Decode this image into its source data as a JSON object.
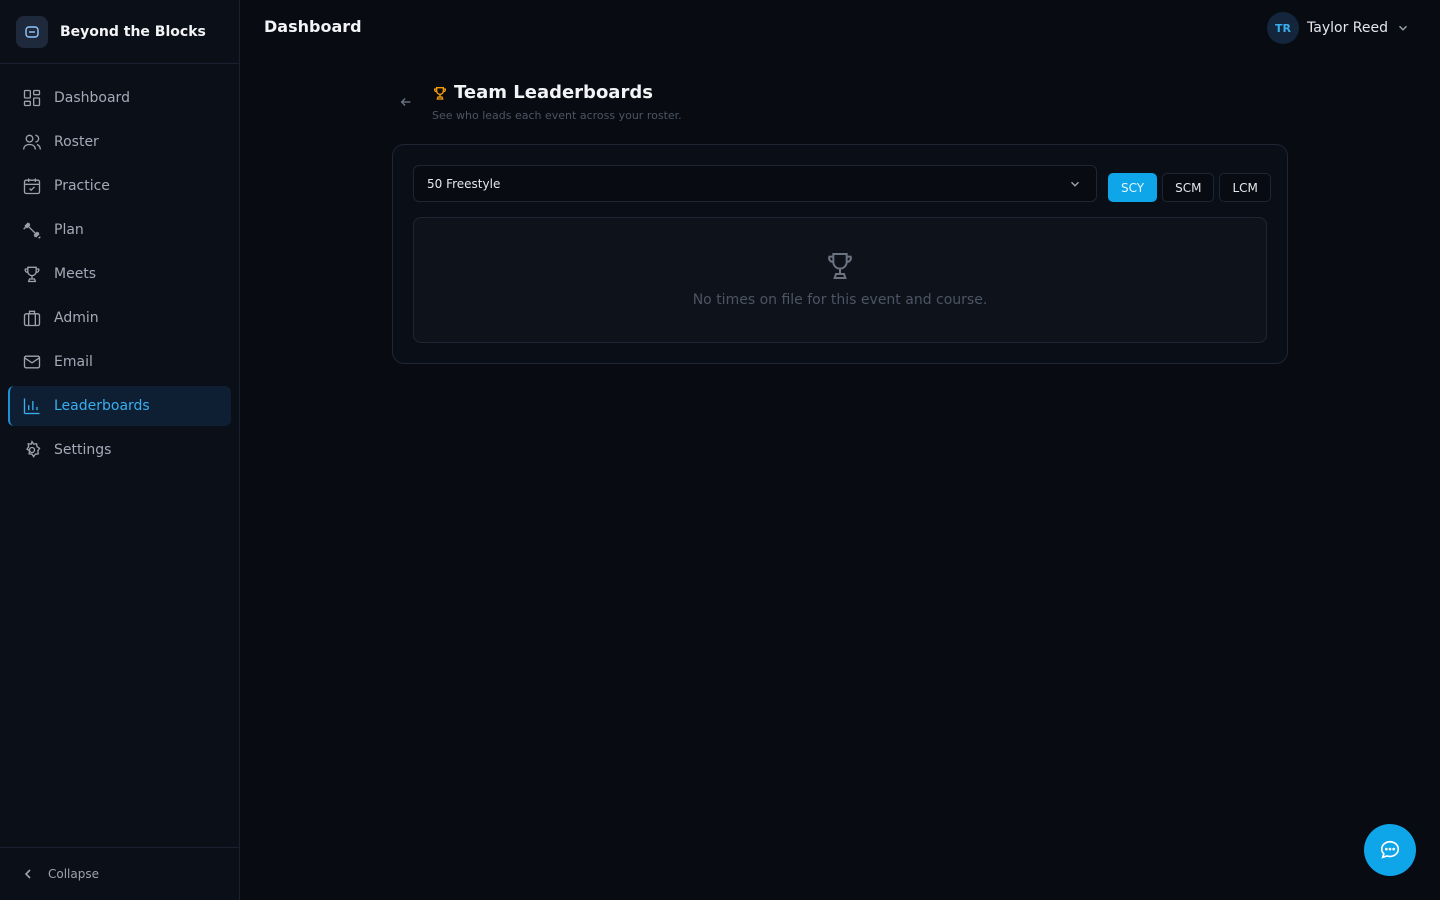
{
  "brand": {
    "name": "Beyond the Blocks",
    "icon": "app-logo-icon"
  },
  "sidebar": {
    "items": [
      {
        "label": "Dashboard",
        "icon": "grid-icon"
      },
      {
        "label": "Roster",
        "icon": "users-icon"
      },
      {
        "label": "Practice",
        "icon": "calendar-check-icon"
      },
      {
        "label": "Plan",
        "icon": "dumbbell-icon"
      },
      {
        "label": "Meets",
        "icon": "trophy-icon"
      },
      {
        "label": "Admin",
        "icon": "briefcase-icon"
      },
      {
        "label": "Email",
        "icon": "mail-icon"
      },
      {
        "label": "Leaderboards",
        "icon": "bar-chart-icon",
        "active": true
      },
      {
        "label": "Settings",
        "icon": "gear-icon"
      }
    ],
    "collapse_label": "Collapse"
  },
  "header": {
    "title": "Dashboard",
    "user": {
      "initials": "TR",
      "name": "Taylor Reed"
    }
  },
  "page": {
    "title": "Team Leaderboards",
    "subtitle": "See who leads each event across your roster."
  },
  "filters": {
    "event_selected": "50 Freestyle",
    "courses": [
      "SCY",
      "SCM",
      "LCM"
    ],
    "active_course": "SCY"
  },
  "empty_state": {
    "message": "No times on file for this event and course."
  },
  "colors": {
    "accent": "#0ea5e9",
    "active_nav_text": "#38aef0",
    "trophy": "#f59e0b",
    "background": "#080b12"
  }
}
